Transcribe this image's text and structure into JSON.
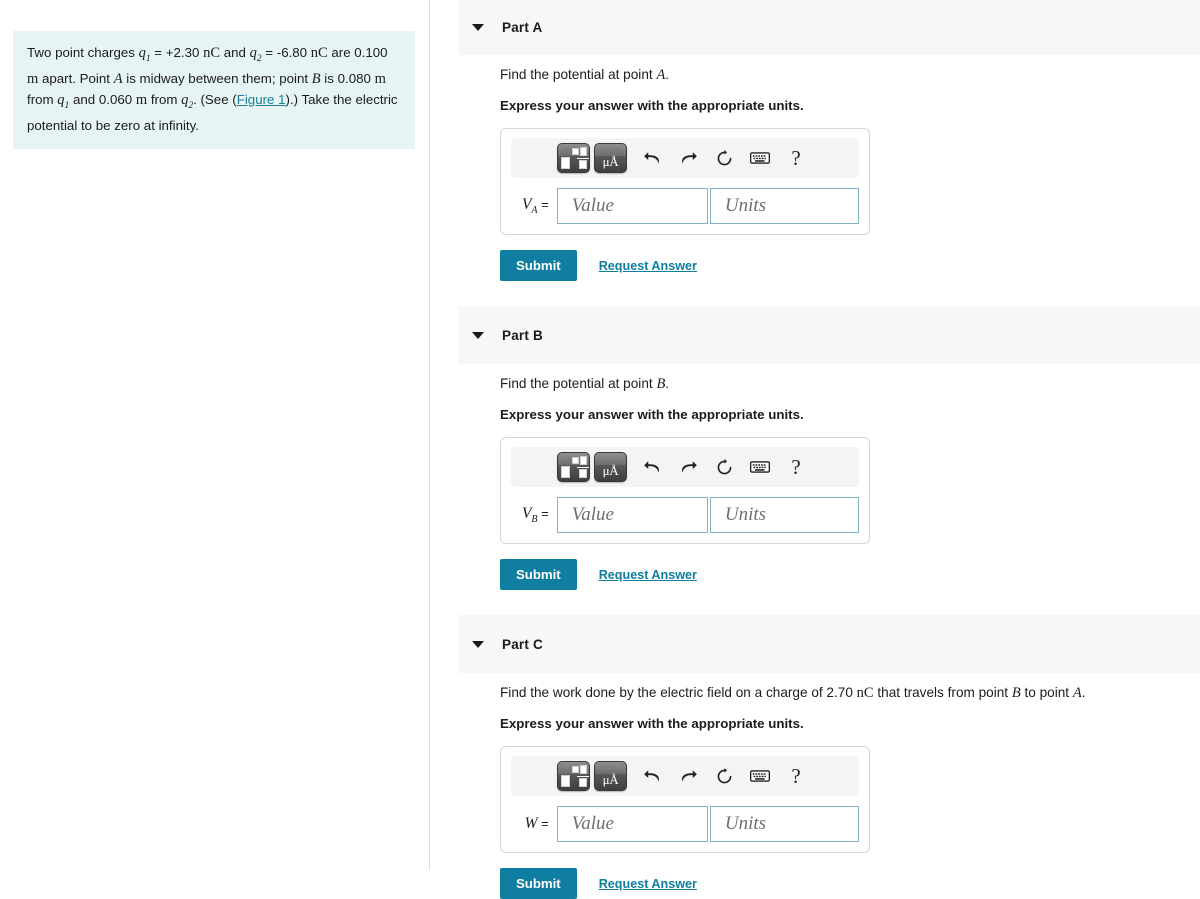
{
  "problem": {
    "segments": [
      {
        "t": "text",
        "v": "Two point charges "
      },
      {
        "t": "var",
        "v": "q",
        "sub": "1"
      },
      {
        "t": "text",
        "v": " = +2.30 "
      },
      {
        "t": "unit",
        "v": "nC"
      },
      {
        "t": "text",
        "v": " and "
      },
      {
        "t": "var",
        "v": "q",
        "sub": "2"
      },
      {
        "t": "text",
        "v": " = -6.80 "
      },
      {
        "t": "unit",
        "v": "nC"
      },
      {
        "t": "text",
        "v": " are 0.100 "
      },
      {
        "t": "unit",
        "v": "m"
      },
      {
        "t": "text",
        "v": " apart. Point "
      },
      {
        "t": "var",
        "v": "A"
      },
      {
        "t": "text",
        "v": " is midway between them; point "
      },
      {
        "t": "var",
        "v": "B"
      },
      {
        "t": "text",
        "v": " is 0.080 "
      },
      {
        "t": "unit",
        "v": "m"
      },
      {
        "t": "text",
        "v": " from "
      },
      {
        "t": "var",
        "v": "q",
        "sub": "1"
      },
      {
        "t": "text",
        "v": " and 0.060 "
      },
      {
        "t": "unit",
        "v": "m"
      },
      {
        "t": "text",
        "v": " from "
      },
      {
        "t": "var",
        "v": "q",
        "sub": "2"
      },
      {
        "t": "text",
        "v": ". (See ("
      },
      {
        "t": "link",
        "v": "Figure 1"
      },
      {
        "t": "text",
        "v": ").) Take the electric potential to be zero at infinity."
      }
    ],
    "plain": "Two point charges q1 = +2.30 nC and q2 = -6.80 nC are 0.100 m apart. Point A is midway between them; point B is 0.080 m from q1 and 0.060 m from q2. (See (Figure 1).) Take the electric potential to be zero at infinity.",
    "figure_link": "Figure 1"
  },
  "toolbar": {
    "template_button": "math-template",
    "units_button": "μÅ",
    "undo": "undo",
    "redo": "redo",
    "reset": "reset",
    "keyboard": "keyboard",
    "help": "?"
  },
  "common": {
    "express_units": "Express your answer with the appropriate units.",
    "value_placeholder": "Value",
    "units_placeholder": "Units",
    "submit_label": "Submit",
    "request_answer_label": "Request Answer",
    "value_current": "",
    "units_current": ""
  },
  "parts": [
    {
      "id": "part-a",
      "title": "Part A",
      "prompt_segments": [
        {
          "t": "text",
          "v": "Find the potential at point "
        },
        {
          "t": "var",
          "v": "A"
        },
        {
          "t": "text",
          "v": "."
        }
      ],
      "prompt_plain": "Find the potential at point A.",
      "variable": "V",
      "variable_sub": "A"
    },
    {
      "id": "part-b",
      "title": "Part B",
      "prompt_segments": [
        {
          "t": "text",
          "v": "Find the potential at point "
        },
        {
          "t": "var",
          "v": "B"
        },
        {
          "t": "text",
          "v": "."
        }
      ],
      "prompt_plain": "Find the potential at point B.",
      "variable": "V",
      "variable_sub": "B"
    },
    {
      "id": "part-c",
      "title": "Part C",
      "prompt_segments": [
        {
          "t": "text",
          "v": "Find the work done by the electric field on a charge of 2.70 "
        },
        {
          "t": "unit",
          "v": "nC"
        },
        {
          "t": "text",
          "v": " that travels from point "
        },
        {
          "t": "var",
          "v": "B"
        },
        {
          "t": "text",
          "v": " to point "
        },
        {
          "t": "var",
          "v": "A"
        },
        {
          "t": "text",
          "v": "."
        }
      ],
      "prompt_plain": "Find the work done by the electric field on a charge of 2.70 nC that travels from point B to point A.",
      "variable": "W",
      "variable_sub": ""
    }
  ],
  "colors": {
    "accent": "#0f7ea0",
    "problem_bg": "#e6f4f3",
    "band_bg": "#f7f7f7",
    "field_border": "#7fb4c4"
  }
}
